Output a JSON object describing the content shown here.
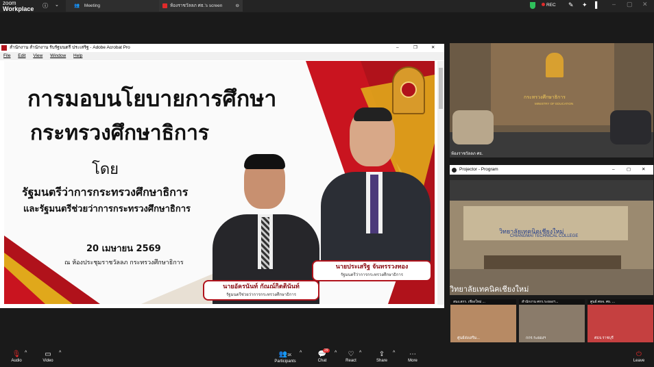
{
  "app": {
    "brand_line1": "zoom",
    "brand_line2": "Workplace"
  },
  "tabs": [
    {
      "label": "Meeting"
    },
    {
      "label": "ห้องราชวัลลภ ศธ.'s screen"
    }
  ],
  "recording": {
    "label": "REC"
  },
  "acrobat": {
    "title": "สำนักงาน สำนักงาน รับรัฐมนตรี ประเสริฐ - Adobe Acrobat Pro",
    "menu": [
      "File",
      "Edit",
      "View",
      "Window",
      "Help"
    ]
  },
  "slide": {
    "title_line1": "การมอบนโยบายการศึกษา",
    "title_line2": "กระทรวงศึกษาธิการ",
    "by": "โดย",
    "line1": "รัฐมนตรีว่าการกระทรวงศึกษาธิการ",
    "line2": "และรัฐมนตรีช่วยว่าการกระทรวงศึกษาธิการ",
    "date": "20 เมษายน 2569",
    "location": "ณ ห้องประชุมราชวัลลภ  กระทรวงศึกษาธิการ",
    "person1_name": "นายประเสริฐ จันทรรวงทอง",
    "person1_role": "รัฐมนตรีว่าการกระทรวงศึกษาธิการ",
    "person2_name": "นายอัครนันท์ กัณณ์กิตตินันท์",
    "person2_role": "รัฐมนตรีช่วยว่าการกระทรวงศึกษาธิการ"
  },
  "cam1": {
    "banner": "กระทรวงศึกษาธิการ",
    "banner_en": "MINISTRY OF EDUCATION",
    "label": "ห้องราชวัลลภ ศธ."
  },
  "projector": {
    "title": "Projector - Program",
    "banner": "วิทยาลัยเทคนิคเชียงใหม่",
    "banner_en": "CHIANGMAI TECHNICAL COLLEGE",
    "label": "วิทยาลัยเทคนิคเชียงใหม่"
  },
  "thumbs": [
    {
      "top": "สนง.สกร. เชียงใหม่ ...",
      "label": "ศูนย์ส่งเสริม..."
    },
    {
      "top": "สำนักงาน ศกร.ระยองฯ...",
      "label": "กกร.ระยองฯ"
    },
    {
      "top": "ศูนย์ ศธจ. ศธ. ...",
      "label": "ศธจ.ราชบุรี"
    }
  ],
  "toolbar": {
    "audio": "Audio",
    "video": "Video",
    "participants": "Participants",
    "participants_count": "1K",
    "chat": "Chat",
    "chat_badge": "29",
    "react": "React",
    "share": "Share",
    "more": "More",
    "leave": "Leave"
  },
  "colors": {
    "accent_red": "#b0121b",
    "gold": "#e0a81b",
    "rec_red": "#e02a2a",
    "bg": "#1a1a1a"
  }
}
